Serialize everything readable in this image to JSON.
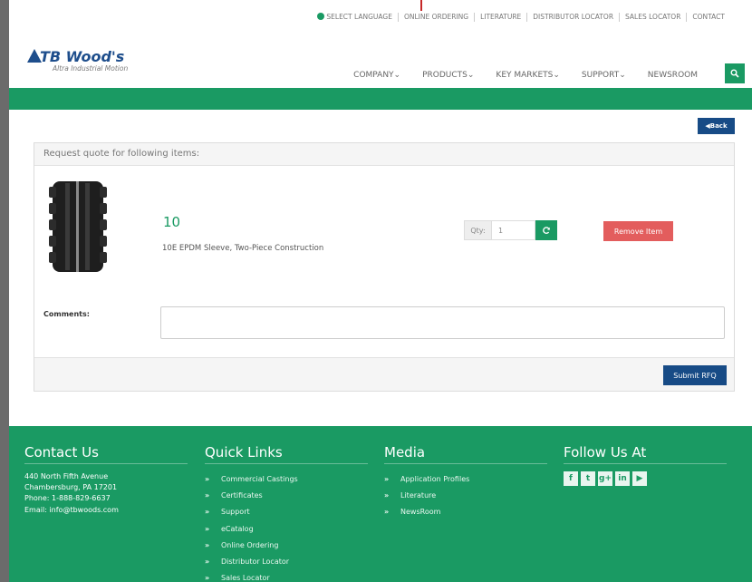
{
  "topbar": {
    "items": [
      "SELECT LANGUAGE",
      "ONLINE ORDERING",
      "LITERATURE",
      "DISTRIBUTOR LOCATOR",
      "SALES LOCATOR",
      "CONTACT"
    ]
  },
  "logo": {
    "brand": "TB Wood's",
    "tagline": "Altra Industrial Motion"
  },
  "nav": {
    "items": [
      "COMPANY",
      "PRODUCTS",
      "KEY MARKETS",
      "SUPPORT",
      "NEWSROOM"
    ]
  },
  "back_label": "Back",
  "panel": {
    "heading": "Request quote for following items:",
    "item": {
      "number": "10",
      "description": "10E EPDM Sleeve, Two-Piece Construction",
      "qty_label": "Qty:",
      "qty_value": "1",
      "remove_label": "Remove Item"
    },
    "comments_label": "Comments:",
    "submit_label": "Submit RFQ"
  },
  "footer": {
    "contact": {
      "title": "Contact Us",
      "lines": [
        "440 North Fifth Avenue",
        "Chambersburg, PA 17201",
        "Phone: 1-888-829-6637",
        "Email: info@tbwoods.com"
      ]
    },
    "quick_links": {
      "title": "Quick Links",
      "items": [
        "Commercial Castings",
        "Certificates",
        "Support",
        "eCatalog",
        "Online Ordering",
        "Distributor Locator",
        "Sales Locator"
      ]
    },
    "media": {
      "title": "Media",
      "items": [
        "Application Profiles",
        "Literature",
        "NewsRoom"
      ]
    },
    "follow": {
      "title": "Follow Us At",
      "icons": [
        "facebook-icon",
        "twitter-icon",
        "google-plus-icon",
        "linkedin-icon",
        "youtube-icon"
      ]
    }
  },
  "colors": {
    "brand_green": "#1a9a63",
    "brand_blue": "#174b86",
    "remove_red": "#e35d5d"
  }
}
